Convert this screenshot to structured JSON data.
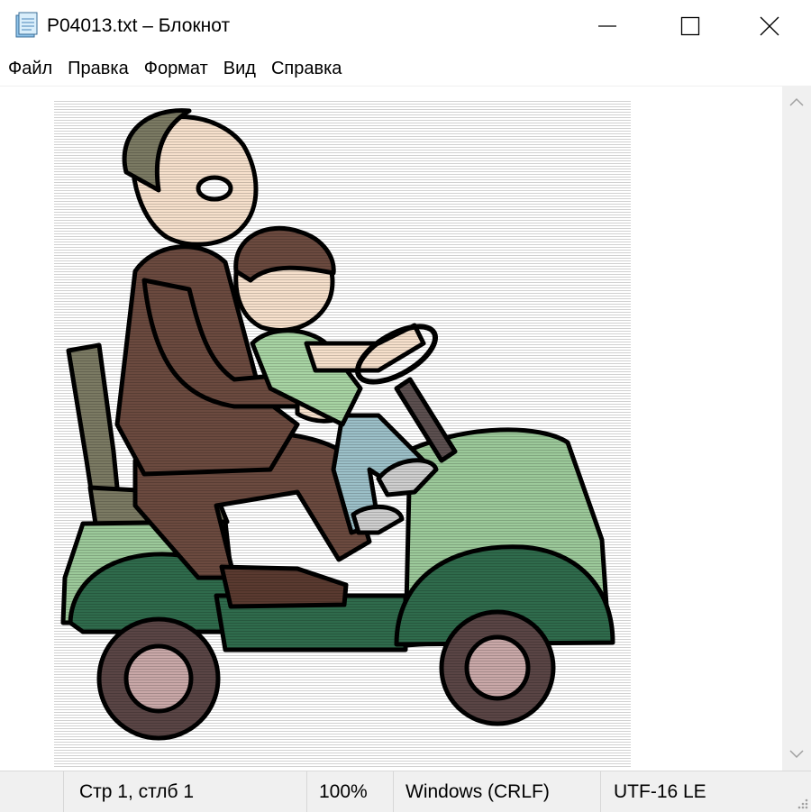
{
  "window": {
    "title": "P04013.txt – Блокнот",
    "icon": "notepad-icon",
    "controls": {
      "minimize": "minimize-icon",
      "maximize": "maximize-icon",
      "close": "close-icon"
    }
  },
  "menu": {
    "items": [
      {
        "label": "Файл"
      },
      {
        "label": "Правка"
      },
      {
        "label": "Формат"
      },
      {
        "label": "Вид"
      },
      {
        "label": "Справка"
      }
    ]
  },
  "content": {
    "illustration": "cartoon of a man and a boy driving a green golf cart",
    "colors": {
      "cart_green": "#9cc99a",
      "cart_dark_green": "#2f6b4c",
      "suit_brown": "#6b4a3f",
      "shirt_green": "#a8d4a4",
      "skin": "#f6e0cc",
      "wheel_pink": "#c9a8a8"
    }
  },
  "scrollbar": {
    "up": "chevron-up-icon",
    "down": "chevron-down-icon"
  },
  "status": {
    "position": "Стр 1, стлб 1",
    "zoom": "100%",
    "line_endings": "Windows (CRLF)",
    "encoding": "UTF-16 LE"
  }
}
